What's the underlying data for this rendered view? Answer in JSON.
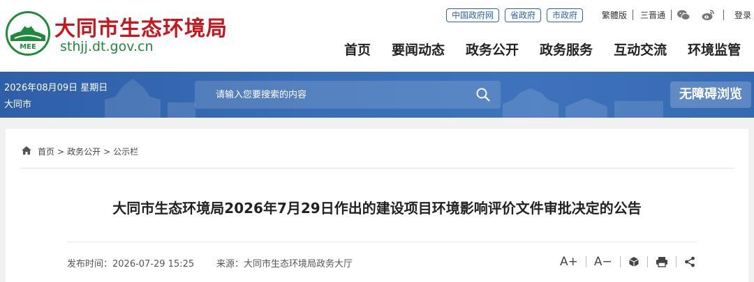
{
  "header": {
    "site_name": "大同市生态环境局",
    "site_url": "sthjj.dt.gov.cn",
    "logo_text": "MEE",
    "gov_links": [
      "中国政府网",
      "省政府",
      "市政府"
    ],
    "utils": {
      "traditional": "繁體版",
      "sanjin": "三晋通",
      "login": "登录",
      "wechat_icon": "wechat-icon",
      "weibo_icon": "weibo-icon"
    },
    "nav": [
      "首页",
      "要闻动态",
      "政务公开",
      "政务服务",
      "互动交流",
      "环境监管"
    ]
  },
  "banner": {
    "date": "2026年08月09日 星期日",
    "city": "大同市",
    "search_placeholder": "请输入您要搜索的内容",
    "search_icon": "search-icon",
    "accessibility": "无障碍浏览"
  },
  "article": {
    "breadcrumb": [
      "首页",
      "政务公开",
      "公示栏"
    ],
    "breadcrumb_sep": ">",
    "title": "大同市生态环境局2026年7月29日作出的建设项目环境影响评价文件审批决定的公告",
    "publish_time": "发布时间：2026-07-29 15:25",
    "source": "来源：大同市生态环境局政务大厅",
    "tools": {
      "font_up": "A+",
      "font_down": "A−"
    }
  },
  "colors": {
    "brand_red": "#c8161d",
    "brand_green": "#1f8a3b",
    "banner_blue": "#3a6db6",
    "link_blue": "#2b62b2"
  }
}
